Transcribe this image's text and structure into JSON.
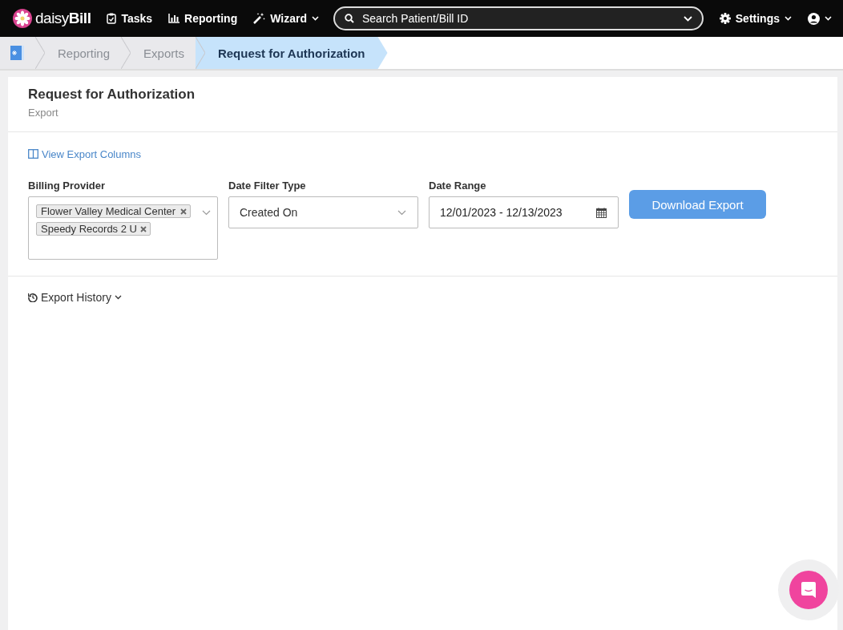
{
  "navbar": {
    "logo": "daisy**Bill**",
    "items": [
      {
        "label": "Tasks",
        "kind": "tasks",
        "dropdown": false
      },
      {
        "label": "Reporting",
        "kind": "reporting",
        "dropdown": false
      },
      {
        "label": "Wizard",
        "kind": "wizard",
        "dropdown": true
      }
    ],
    "search": {
      "placeholder": "Search Patient/Bill ID"
    },
    "settings": {
      "label": "Settings"
    }
  },
  "breadcrumbs": [
    {
      "label": "Reporting",
      "selected": false
    },
    {
      "label": "Exports",
      "selected": false
    },
    {
      "label": "Request for Authorization",
      "selected": true
    }
  ],
  "page": {
    "title": "Request for Authorization",
    "subtitle": "Export",
    "columns_link": "View Export Columns",
    "billing_provider": {
      "label": "Billing Provider",
      "tags": [
        "Flower Valley Medical Center",
        "Speedy Records 2 U"
      ]
    },
    "date_filter_type": {
      "label": "Date Filter Type",
      "value": "Created On"
    },
    "date_range": {
      "label": "Date Range",
      "value": "12/01/2023 - 12/13/2023"
    },
    "download_button": "Download Export",
    "history_toggle": {
      "label": "Export History",
      "expanded": false
    }
  }
}
